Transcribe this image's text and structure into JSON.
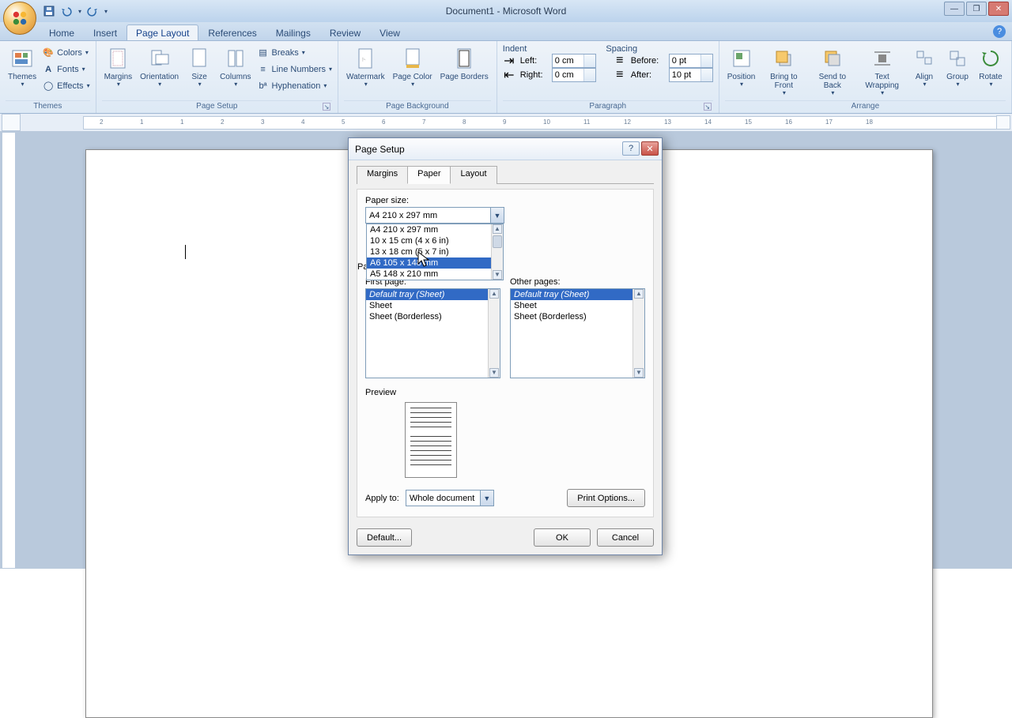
{
  "titlebar": {
    "title": "Document1 - Microsoft Word"
  },
  "tabs": {
    "home": "Home",
    "insert": "Insert",
    "page_layout": "Page Layout",
    "references": "References",
    "mailings": "Mailings",
    "review": "Review",
    "view": "View"
  },
  "ribbon": {
    "themes": {
      "title": "Themes",
      "themes": "Themes",
      "colors": "Colors",
      "fonts": "Fonts",
      "effects": "Effects"
    },
    "page_setup": {
      "title": "Page Setup",
      "margins": "Margins",
      "orientation": "Orientation",
      "size": "Size",
      "columns": "Columns",
      "breaks": "Breaks",
      "line_numbers": "Line Numbers",
      "hyphenation": "Hyphenation"
    },
    "page_background": {
      "title": "Page Background",
      "watermark": "Watermark",
      "page_color": "Page Color",
      "page_borders": "Page Borders"
    },
    "paragraph": {
      "title": "Paragraph",
      "indent": "Indent",
      "left": "Left:",
      "right": "Right:",
      "left_val": "0 cm",
      "right_val": "0 cm",
      "spacing": "Spacing",
      "before": "Before:",
      "after": "After:",
      "before_val": "0 pt",
      "after_val": "10 pt"
    },
    "arrange": {
      "title": "Arrange",
      "position": "Position",
      "bring_front": "Bring to Front",
      "send_back": "Send to Back",
      "text_wrap": "Text Wrapping",
      "align": "Align",
      "group": "Group",
      "rotate": "Rotate"
    }
  },
  "dialog": {
    "title": "Page Setup",
    "tabs": {
      "margins": "Margins",
      "paper": "Paper",
      "layout": "Layout"
    },
    "paper_size_label": "Paper size:",
    "paper_size_value": "A4 210 x 297 mm",
    "paper_options": [
      "A4 210 x 297 mm",
      "10 x 15 cm (4 x 6 in)",
      "13 x 18 cm (5 x 7 in)",
      "A6 105 x 148 mm",
      "A5 148 x 210 mm"
    ],
    "paper_source_prefix": "Pa",
    "first_page": "First page:",
    "other_pages": "Other pages:",
    "tray_options": [
      "Default tray (Sheet)",
      "Sheet",
      "Sheet (Borderless)"
    ],
    "preview": "Preview",
    "apply_to": "Apply to:",
    "apply_value": "Whole document",
    "print_options": "Print Options...",
    "default": "Default...",
    "ok": "OK",
    "cancel": "Cancel"
  },
  "ruler_numbers": [
    "2",
    "1",
    "1",
    "2",
    "3",
    "4",
    "5",
    "6",
    "7",
    "8",
    "9",
    "10",
    "11",
    "12",
    "13",
    "14",
    "15",
    "16",
    "17",
    "18"
  ]
}
